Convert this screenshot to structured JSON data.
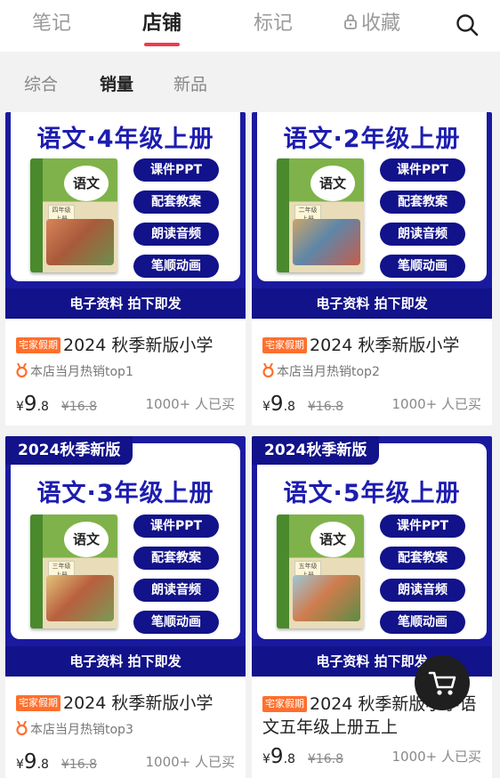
{
  "top_tabs": {
    "notes": "笔记",
    "shop": "店铺",
    "marks": "标记",
    "collect": "收藏"
  },
  "sub_tabs": {
    "overall": "综合",
    "sales": "销量",
    "new": "新品"
  },
  "poster_common": {
    "banner": "2024秋季新版",
    "book_title": "语文",
    "pill_1": "课件PPT",
    "pill_2": "配套教案",
    "pill_3": "朗读音频",
    "pill_4": "笔顺动画",
    "footer": "电子资料 拍下即发"
  },
  "products": [
    {
      "poster_title": "语文·4年级上册",
      "grade": "四年级 上册",
      "tag": "宅家假期",
      "name": "2024 秋季新版小学",
      "hot": "本店当月热销top1",
      "currency": "¥",
      "price_int": "9",
      "price_dec": ".8",
      "original": "¥16.8",
      "sold": "1000+ 人已买"
    },
    {
      "poster_title": "语文·2年级上册",
      "grade": "二年级 上册",
      "tag": "宅家假期",
      "name": "2024 秋季新版小学",
      "hot": "本店当月热销top2",
      "currency": "¥",
      "price_int": "9",
      "price_dec": ".8",
      "original": "¥16.8",
      "sold": "1000+ 人已买"
    },
    {
      "poster_title": "语文·3年级上册",
      "grade": "三年级 上册",
      "tag": "宅家假期",
      "name": "2024 秋季新版小学",
      "hot": "本店当月热销top3",
      "currency": "¥",
      "price_int": "9",
      "price_dec": ".8",
      "original": "¥16.8",
      "sold": "1000+ 人已买"
    },
    {
      "poster_title": "语文·5年级上册",
      "grade": "五年级 上册",
      "tag": "宅家假期",
      "name": "2024 秋季新版小学语文五年级上册五上",
      "currency": "¥",
      "price_int": "9",
      "price_dec": ".8",
      "original": "¥16.8",
      "sold": "1000+ 人已买"
    }
  ],
  "icons": {
    "search": "search-icon",
    "lock": "lock-icon",
    "medal": "medal-icon",
    "cart": "cart-icon"
  },
  "colors": {
    "accent": "#f03a4c",
    "poster_blue": "#1a1aa0",
    "tag_orange": "#ff6f2c"
  }
}
